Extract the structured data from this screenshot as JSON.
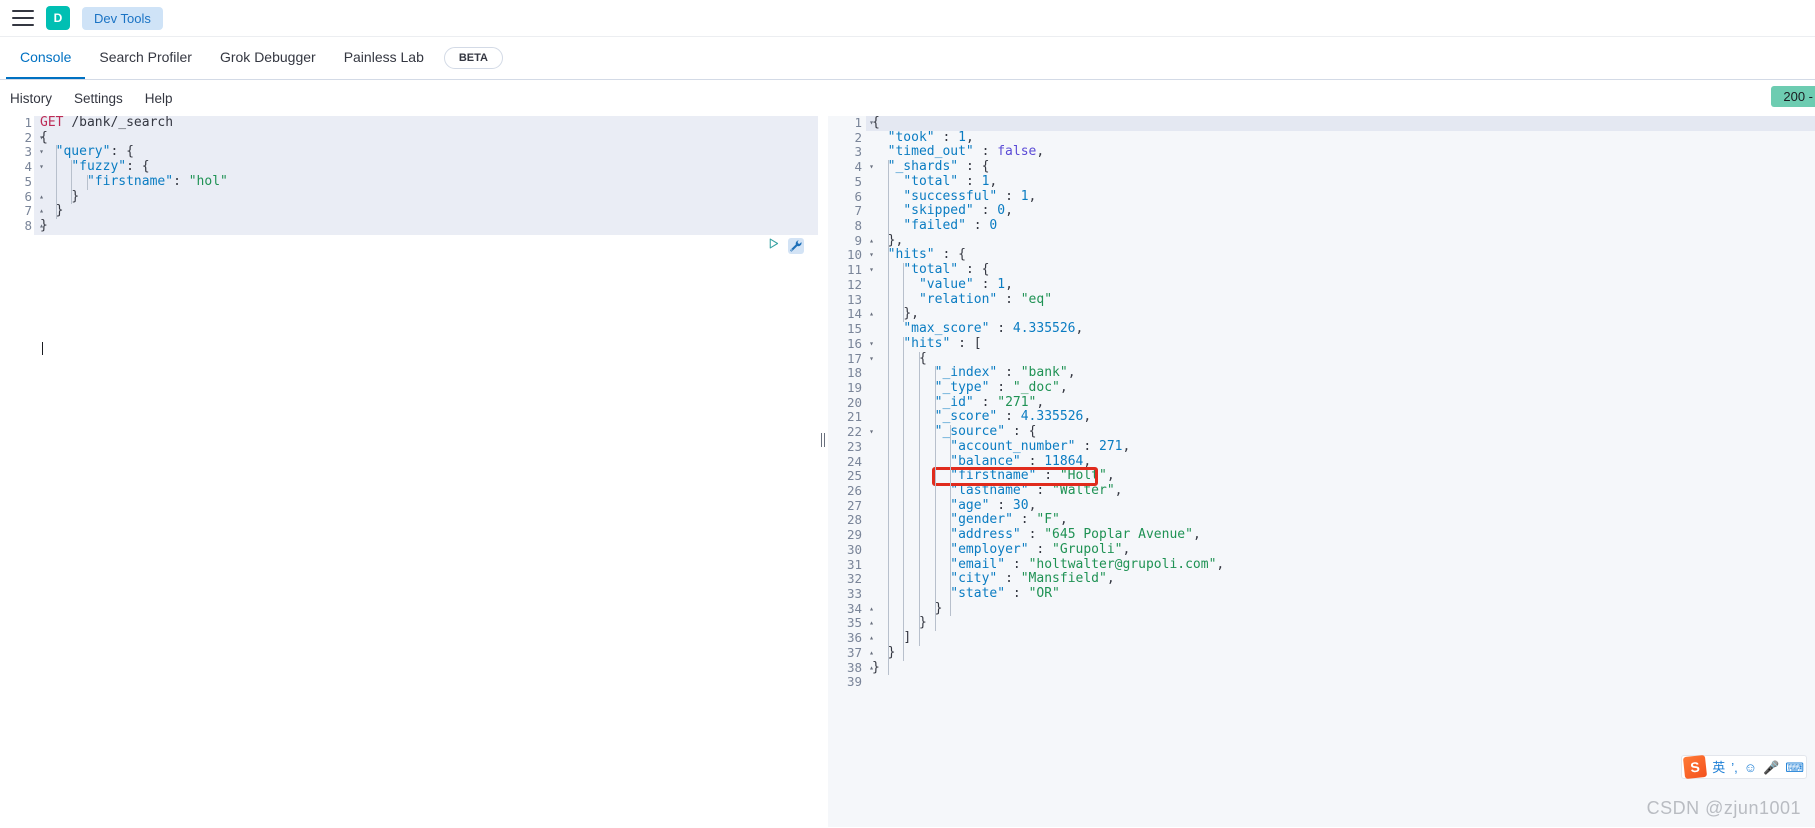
{
  "globalbar": {
    "menu_icon": "hamburger-menu-icon",
    "app_initial": "D",
    "app_pill": "Dev Tools"
  },
  "tabs": [
    {
      "label": "Console",
      "active": true
    },
    {
      "label": "Search Profiler",
      "active": false
    },
    {
      "label": "Grok Debugger",
      "active": false
    },
    {
      "label": "Painless Lab",
      "active": false
    }
  ],
  "beta_pill": "BETA",
  "submenu": {
    "items": [
      "History",
      "Settings",
      "Help"
    ],
    "status": "200 -",
    "status_color": "#6dccb1"
  },
  "editor": {
    "name": "request-editor",
    "play_icon": "play-triangle-icon",
    "wrench_icon": "wrench-icon",
    "lines": [
      {
        "n": 1,
        "fold": "",
        "text": "GET /bank/_search"
      },
      {
        "n": 2,
        "fold": "▾",
        "text": "{"
      },
      {
        "n": 3,
        "fold": "▾",
        "text": "  \"query\": {"
      },
      {
        "n": 4,
        "fold": "▾",
        "text": "    \"fuzzy\": {"
      },
      {
        "n": 5,
        "fold": "",
        "text": "      \"firstname\": \"hol\""
      },
      {
        "n": 6,
        "fold": "▴",
        "text": "    }"
      },
      {
        "n": 7,
        "fold": "▴",
        "text": "  }"
      },
      {
        "n": 8,
        "fold": "▴",
        "text": "}"
      }
    ]
  },
  "output": {
    "name": "response-viewer",
    "lines": [
      {
        "n": 1,
        "fold": "▾",
        "text": "{"
      },
      {
        "n": 2,
        "fold": "",
        "text": "  \"took\" : 1,"
      },
      {
        "n": 3,
        "fold": "",
        "text": "  \"timed_out\" : false,"
      },
      {
        "n": 4,
        "fold": "▾",
        "text": "  \"_shards\" : {"
      },
      {
        "n": 5,
        "fold": "",
        "text": "    \"total\" : 1,"
      },
      {
        "n": 6,
        "fold": "",
        "text": "    \"successful\" : 1,"
      },
      {
        "n": 7,
        "fold": "",
        "text": "    \"skipped\" : 0,"
      },
      {
        "n": 8,
        "fold": "",
        "text": "    \"failed\" : 0"
      },
      {
        "n": 9,
        "fold": "▴",
        "text": "  },"
      },
      {
        "n": 10,
        "fold": "▾",
        "text": "  \"hits\" : {"
      },
      {
        "n": 11,
        "fold": "▾",
        "text": "    \"total\" : {"
      },
      {
        "n": 12,
        "fold": "",
        "text": "      \"value\" : 1,"
      },
      {
        "n": 13,
        "fold": "",
        "text": "      \"relation\" : \"eq\""
      },
      {
        "n": 14,
        "fold": "▴",
        "text": "    },"
      },
      {
        "n": 15,
        "fold": "",
        "text": "    \"max_score\" : 4.335526,"
      },
      {
        "n": 16,
        "fold": "▾",
        "text": "    \"hits\" : ["
      },
      {
        "n": 17,
        "fold": "▾",
        "text": "      {"
      },
      {
        "n": 18,
        "fold": "",
        "text": "        \"_index\" : \"bank\","
      },
      {
        "n": 19,
        "fold": "",
        "text": "        \"_type\" : \"_doc\","
      },
      {
        "n": 20,
        "fold": "",
        "text": "        \"_id\" : \"271\","
      },
      {
        "n": 21,
        "fold": "",
        "text": "        \"_score\" : 4.335526,"
      },
      {
        "n": 22,
        "fold": "▾",
        "text": "        \"_source\" : {"
      },
      {
        "n": 23,
        "fold": "",
        "text": "          \"account_number\" : 271,"
      },
      {
        "n": 24,
        "fold": "",
        "text": "          \"balance\" : 11864,"
      },
      {
        "n": 25,
        "fold": "",
        "text": "          \"firstname\" : \"Holt\","
      },
      {
        "n": 26,
        "fold": "",
        "text": "          \"lastname\" : \"Walter\","
      },
      {
        "n": 27,
        "fold": "",
        "text": "          \"age\" : 30,"
      },
      {
        "n": 28,
        "fold": "",
        "text": "          \"gender\" : \"F\","
      },
      {
        "n": 29,
        "fold": "",
        "text": "          \"address\" : \"645 Poplar Avenue\","
      },
      {
        "n": 30,
        "fold": "",
        "text": "          \"employer\" : \"Grupoli\","
      },
      {
        "n": 31,
        "fold": "",
        "text": "          \"email\" : \"holtwalter@grupoli.com\","
      },
      {
        "n": 32,
        "fold": "",
        "text": "          \"city\" : \"Mansfield\","
      },
      {
        "n": 33,
        "fold": "",
        "text": "          \"state\" : \"OR\""
      },
      {
        "n": 34,
        "fold": "▴",
        "text": "        }"
      },
      {
        "n": 35,
        "fold": "▴",
        "text": "      }"
      },
      {
        "n": 36,
        "fold": "▴",
        "text": "    ]"
      },
      {
        "n": 37,
        "fold": "▴",
        "text": "  }"
      },
      {
        "n": 38,
        "fold": "▴",
        "text": "}"
      },
      {
        "n": 39,
        "fold": "",
        "text": ""
      }
    ],
    "highlight": {
      "label": "firstname-highlight-box",
      "line": 25,
      "color": "#e02b1d"
    }
  },
  "ime": {
    "logo": "S",
    "items": [
      "英",
      "’,",
      "☺",
      "🎤",
      "⌨"
    ]
  },
  "watermark": "CSDN @zjun1001"
}
